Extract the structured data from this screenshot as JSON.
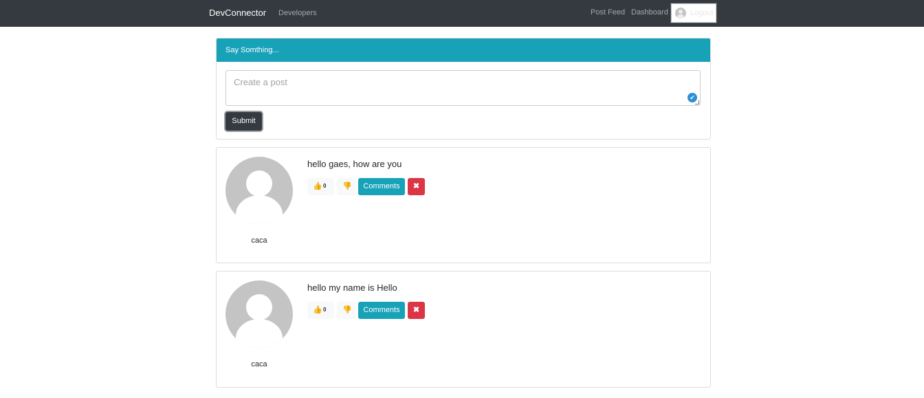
{
  "navbar": {
    "brand": "DevConnector",
    "developers": "Developers",
    "post_feed": "Post Feed",
    "dashboard": "Dashboard",
    "logout": "Logout"
  },
  "post_form": {
    "header": "Say Somthing...",
    "placeholder": "Create a post",
    "submit_label": "Submit"
  },
  "posts": [
    {
      "author": "caca",
      "text": "hello gaes, how are you",
      "likes": "0",
      "comments_label": "Comments",
      "delete_icon": "✖"
    },
    {
      "author": "caca",
      "text": "hello my name is Hello",
      "likes": "0",
      "comments_label": "Comments",
      "delete_icon": "✖"
    }
  ],
  "icons": {
    "thumbs_up": "👍",
    "thumbs_down": "👎",
    "check": "✔"
  },
  "colors": {
    "navbar": "#343a40",
    "accent": "#17a2b8",
    "danger": "#dc3545"
  }
}
